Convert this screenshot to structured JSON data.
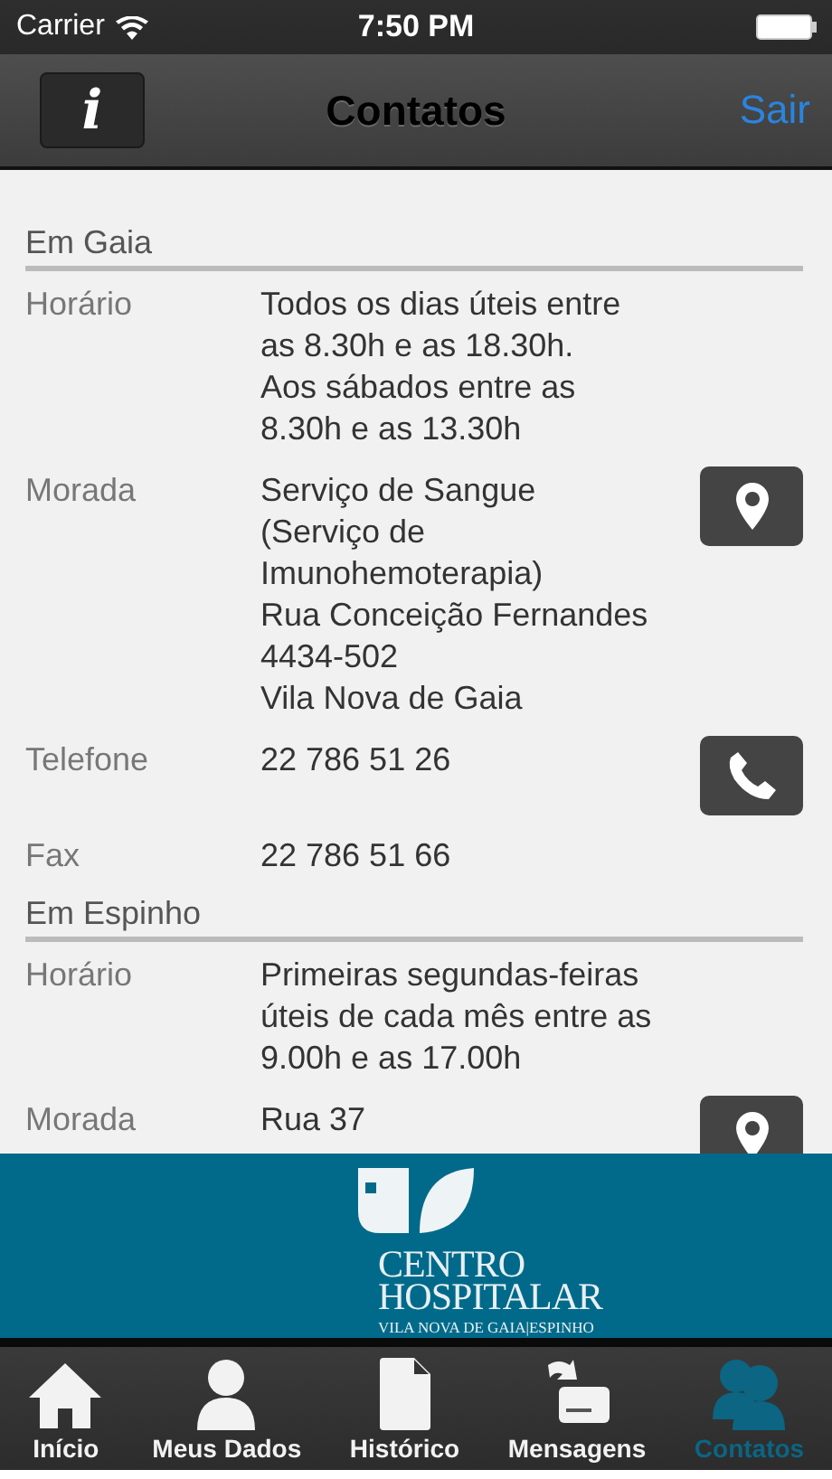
{
  "status_bar": {
    "carrier": "Carrier",
    "time": "7:50 PM"
  },
  "nav_bar": {
    "info_button": "i",
    "title": "Contatos",
    "right_button": "Sair"
  },
  "sections": [
    {
      "title": "Em Gaia",
      "rows": [
        {
          "kind": "text",
          "label": "Horário",
          "lines": [
            "Todos os dias úteis entre",
            "as 8.30h e as 18.30h.",
            "Aos sábados entre as",
            "8.30h e as 13.30h"
          ]
        },
        {
          "kind": "map",
          "label": "Morada",
          "lines": [
            "Serviço de Sangue",
            "(Serviço de",
            "Imunohemoterapia)",
            "Rua Conceição Fernandes",
            "4434-502",
            "Vila Nova de Gaia"
          ]
        },
        {
          "kind": "phone",
          "label": "Telefone",
          "lines": [
            "22 786 51 26"
          ]
        },
        {
          "kind": "text",
          "label": "Fax",
          "lines": [
            "22 786 51 66"
          ]
        }
      ]
    },
    {
      "title": "Em Espinho",
      "rows": [
        {
          "kind": "text",
          "label": "Horário",
          "lines": [
            "Primeiras segundas-feiras",
            "úteis de cada mês entre as",
            "9.00h e as 17.00h"
          ]
        },
        {
          "kind": "map",
          "label": "Morada",
          "lines": [
            "Rua 37"
          ]
        }
      ]
    }
  ],
  "banner": {
    "name_lines": [
      "CENTRO",
      "HOSPITALAR"
    ],
    "subtitle": "VILA NOVA DE GAIA|ESPINHO"
  },
  "tab_bar": [
    {
      "label": "Início",
      "selected": false
    },
    {
      "label": "Meus Dados",
      "selected": false
    },
    {
      "label": "Histórico",
      "selected": false
    },
    {
      "label": "Mensagens",
      "selected": false
    },
    {
      "label": "Contatos",
      "selected": true
    }
  ]
}
